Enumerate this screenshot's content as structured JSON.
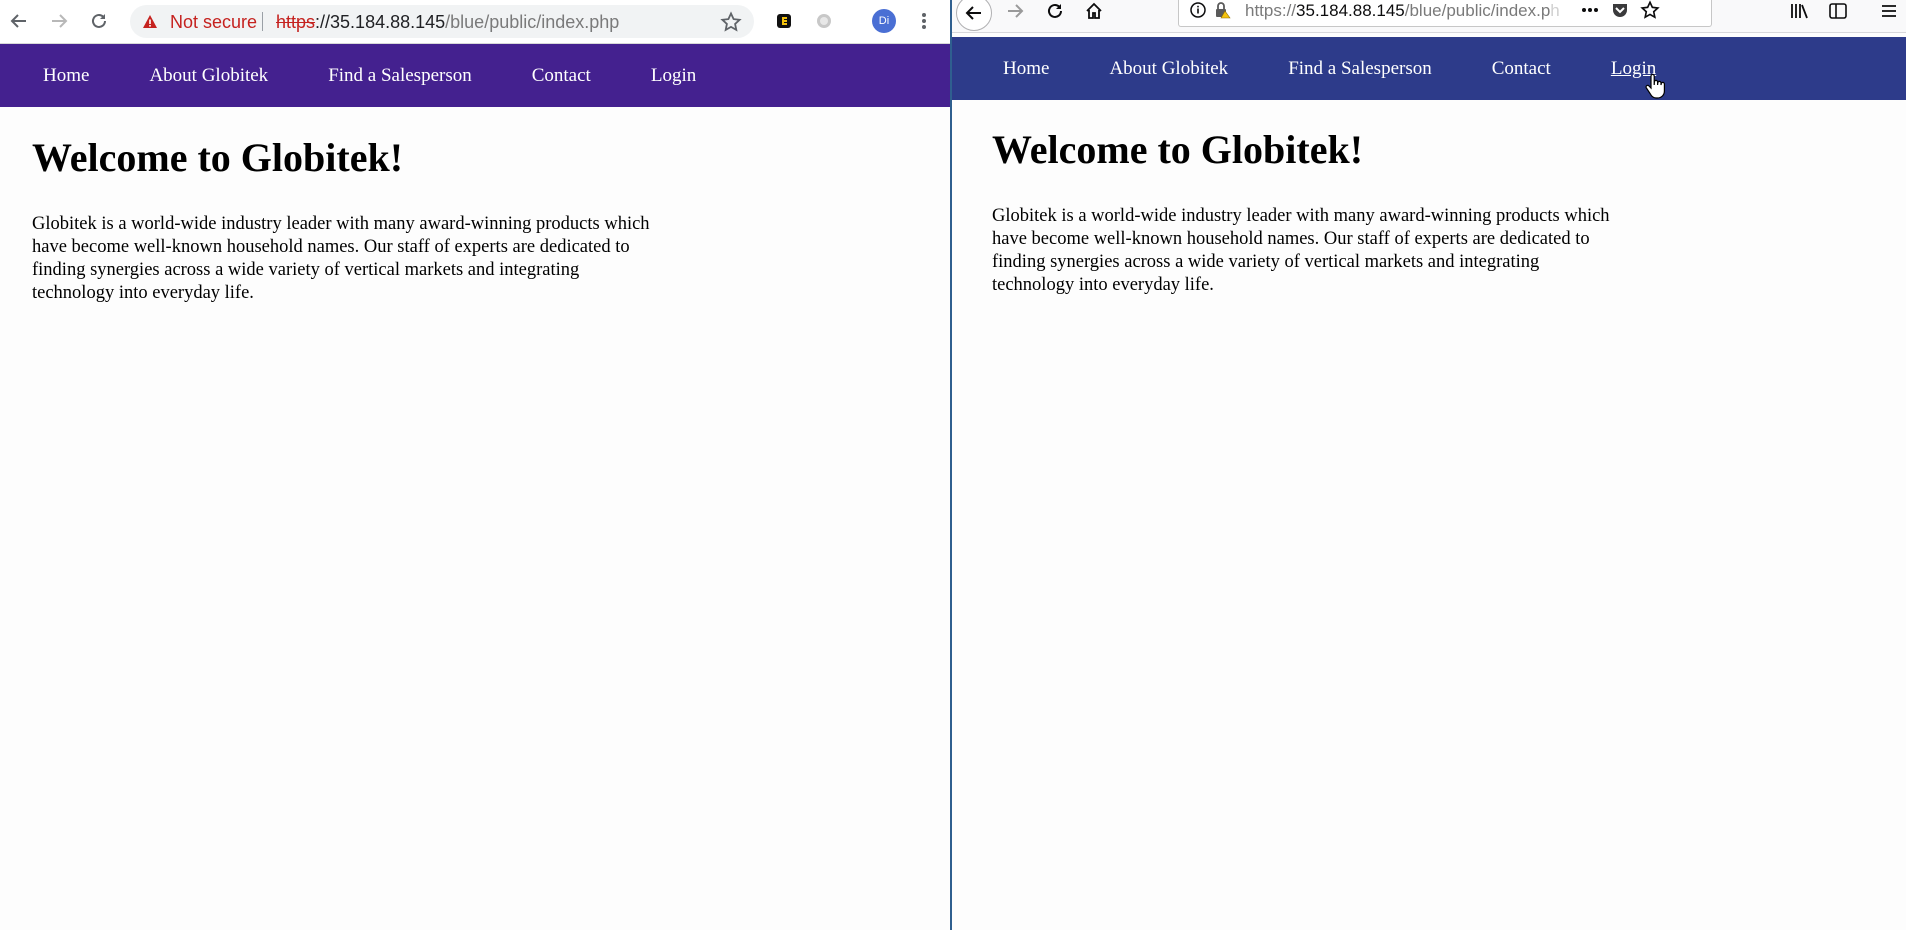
{
  "left_browser": {
    "security_label": "Not secure",
    "url_scheme": "https",
    "url_host": "://35.184.88.145",
    "url_path": "/blue/public/index.php",
    "profile_initials": "Di",
    "nav": [
      "Home",
      "About Globitek",
      "Find a Salesperson",
      "Contact",
      "Login"
    ],
    "title": "Welcome to Globitek!",
    "body_text": "Globitek is a world-wide industry leader with many award-winning products which have become well-known household names. Our staff of experts are dedicated to finding synergies across a wide variety of vertical markets and integrating technology into everyday life."
  },
  "right_browser": {
    "url_scheme": "https://",
    "url_host": "35.184.88.145",
    "url_path": "/blue/public/index.p",
    "url_fade": "h",
    "nav": [
      "Home",
      "About Globitek",
      "Find a Salesperson",
      "Contact",
      "Login"
    ],
    "title": "Welcome to Globitek!",
    "body_text": "Globitek is a world-wide industry leader with many award-winning products which have become well-known household names. Our staff of experts are dedicated to finding synergies across a wide variety of vertical markets and integrating technology into everyday life."
  },
  "colors": {
    "left_nav": "#44218f",
    "right_nav": "#2d3b8a",
    "warning_red": "#c5221f"
  },
  "icons": [
    "back-icon",
    "forward-icon",
    "reload-icon",
    "home-icon",
    "warning-icon",
    "star-icon",
    "extension-icon",
    "menu-icon",
    "info-icon",
    "lock-icon",
    "more-icon",
    "pocket-icon",
    "library-icon",
    "sidebar-icon",
    "hamburger-icon",
    "hand-cursor-icon"
  ]
}
